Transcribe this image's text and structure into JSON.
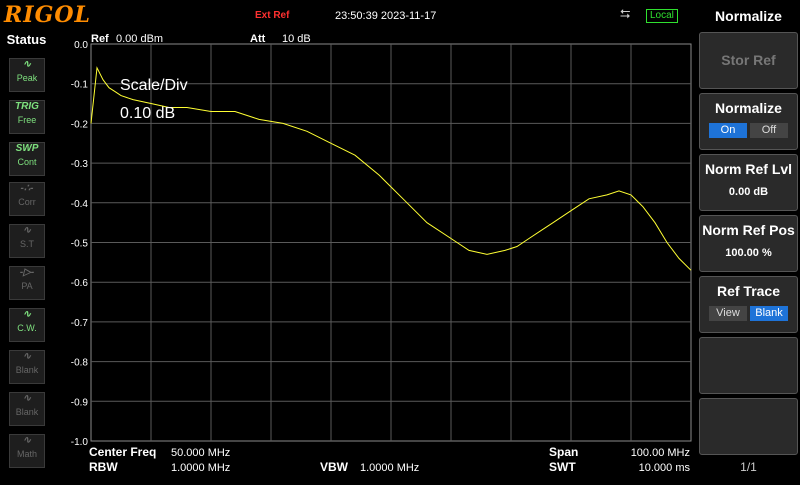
{
  "header": {
    "logo": "RIGOL",
    "ext_ref": "Ext Ref",
    "datetime": "23:50:39 2023-11-17",
    "usb_icon": "usb-icon",
    "local": "Local"
  },
  "status": {
    "title": "Status",
    "buttons": [
      {
        "icon": "Peak",
        "label": "Peak",
        "state": "on",
        "iconText": "∿"
      },
      {
        "icon": "TRIG",
        "label": "Free",
        "state": "on",
        "iconText": "TRIG"
      },
      {
        "icon": "SWP",
        "label": "Cont",
        "state": "on",
        "iconText": "SWP"
      },
      {
        "icon": "Corr",
        "label": "Corr",
        "state": "off",
        "iconText": "-∴-"
      },
      {
        "icon": "S.T",
        "label": "S.T",
        "state": "off",
        "iconText": "∿"
      },
      {
        "icon": "PA",
        "label": "PA",
        "state": "off",
        "iconText": "-▷-"
      },
      {
        "icon": "C.W.",
        "label": "C.W.",
        "state": "on",
        "iconText": "∿"
      },
      {
        "icon": "Blank",
        "label": "Blank",
        "state": "off",
        "iconText": "∿"
      },
      {
        "icon": "Blank",
        "label": "Blank",
        "state": "off",
        "iconText": "∿"
      },
      {
        "icon": "Math",
        "label": "Math",
        "state": "off",
        "iconText": "∿"
      }
    ]
  },
  "plot": {
    "ref_label": "Ref",
    "ref_value": "0.00 dBm",
    "att_label": "Att",
    "att_value": "10 dB",
    "scale_label": "Scale/Div",
    "scale_value": "0.10 dB",
    "center_label": "Center Freq",
    "center_value": "50.000 MHz",
    "rbw_label": "RBW",
    "rbw_value": "1.0000 MHz",
    "vbw_label": "VBW",
    "vbw_value": "1.0000 MHz",
    "span_label": "Span",
    "span_value": "100.00 MHz",
    "swt_label": "SWT",
    "swt_value": "10.000 ms"
  },
  "chart_data": {
    "type": "line",
    "ylim": [
      -1.0,
      0.0
    ],
    "xlim": [
      0,
      100
    ],
    "y_ticks": [
      "0.0",
      "-0.1",
      "-0.2",
      "-0.3",
      "-0.4",
      "-0.5",
      "-0.6",
      "-0.7",
      "-0.8",
      "-0.9",
      "-1.0"
    ],
    "grid": true,
    "trace_color": "#ffff33",
    "series": [
      {
        "x": [
          0,
          1,
          2,
          3,
          4,
          5,
          7,
          10,
          13,
          16,
          20,
          24,
          28,
          32,
          36,
          40,
          44,
          48,
          52,
          56,
          60,
          63,
          66,
          69,
          71,
          73,
          75,
          77,
          80,
          83,
          86,
          88,
          90,
          92,
          94,
          96,
          98,
          100
        ],
        "y": [
          -0.2,
          -0.06,
          -0.09,
          -0.11,
          -0.12,
          -0.13,
          -0.14,
          -0.15,
          -0.16,
          -0.16,
          -0.17,
          -0.17,
          -0.19,
          -0.2,
          -0.22,
          -0.25,
          -0.28,
          -0.33,
          -0.39,
          -0.45,
          -0.49,
          -0.52,
          -0.53,
          -0.52,
          -0.51,
          -0.49,
          -0.47,
          -0.45,
          -0.42,
          -0.39,
          -0.38,
          -0.37,
          -0.38,
          -0.41,
          -0.45,
          -0.5,
          -0.54,
          -0.57
        ]
      }
    ]
  },
  "menu": {
    "title": "Normalize",
    "stor_ref": "Stor Ref",
    "normalize_label": "Normalize",
    "normalize_on": "On",
    "normalize_off": "Off",
    "norm_ref_lvl_label": "Norm Ref Lvl",
    "norm_ref_lvl_value": "0.00 dB",
    "norm_ref_pos_label": "Norm Ref Pos",
    "norm_ref_pos_value": "100.00 %",
    "ref_trace_label": "Ref Trace",
    "ref_trace_view": "View",
    "ref_trace_blank": "Blank",
    "page": "1/1"
  }
}
